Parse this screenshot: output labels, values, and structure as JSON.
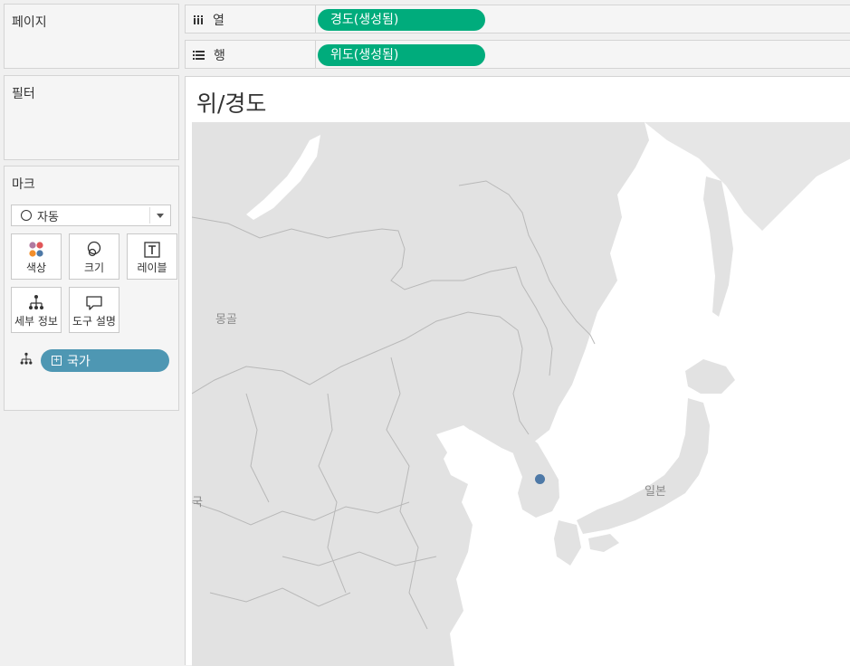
{
  "pages_card": {
    "title": "페이지"
  },
  "filters_card": {
    "title": "필터"
  },
  "marks_card": {
    "title": "마크",
    "mark_type": "자동",
    "buttons": [
      {
        "label": "색상",
        "icon": "color-dots-icon"
      },
      {
        "label": "크기",
        "icon": "size-circles-icon"
      },
      {
        "label": "레이블",
        "icon": "text-label-icon"
      },
      {
        "label": "세부 정보",
        "icon": "detail-hierarchy-icon"
      },
      {
        "label": "도구 설명",
        "icon": "tooltip-bubble-icon"
      }
    ],
    "field_pill": "국가"
  },
  "columns_shelf": {
    "label": "열",
    "pill": "경도(생성됨)"
  },
  "rows_shelf": {
    "label": "행",
    "pill": "위도(생성됨)"
  },
  "view": {
    "title": "위/경도",
    "map_labels": {
      "mongolia": "몽골",
      "japan": "일본",
      "china_fragment": "국"
    }
  },
  "colors": {
    "green_pill": "#00ac7c",
    "blue_pill": "#4e97b3",
    "data_point": "#4e79a7",
    "land": "#e2e2e2",
    "sea": "#ffffff"
  }
}
